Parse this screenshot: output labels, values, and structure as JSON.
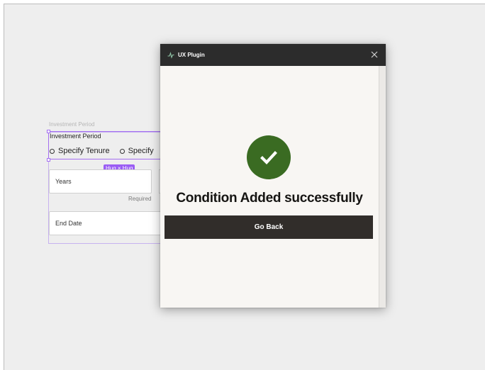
{
  "background_frame": {
    "frame_label": "Investment Period",
    "section_title": "Investment Period",
    "radio_options": [
      "Specify Tenure",
      "Specify"
    ],
    "hug_badge": "Hug × Hug",
    "years_field": "Years",
    "required_text": "Required",
    "end_date_field": "End Date"
  },
  "plugin_modal": {
    "title": "UX Plugin",
    "icon": "plugin-icon",
    "close_icon": "close-icon",
    "success_icon": "check-circle-icon",
    "message": "Condition Added successfully",
    "button_label": "Go Back",
    "colors": {
      "header": "#2c2c2c",
      "body": "#f8f6f3",
      "success": "#3a6b22",
      "button": "#312d2a",
      "selection": "#a46ff0"
    }
  }
}
